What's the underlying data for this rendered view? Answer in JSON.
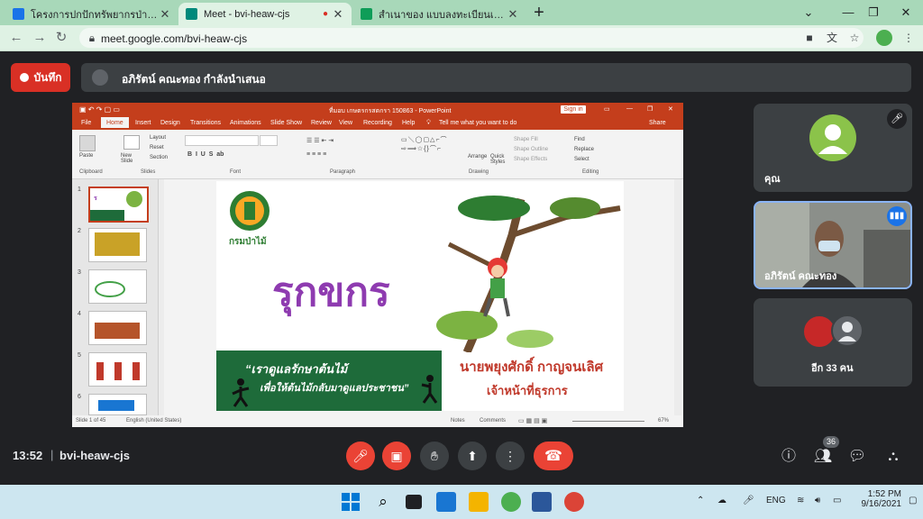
{
  "browser": {
    "tabs": [
      {
        "title": "โครงการปกปักทรัพยากรป่าตะเคียนทอง",
        "favicon_color": "#1a73e8"
      },
      {
        "title": "Meet - bvi-heaw-cjs",
        "favicon_color": "#00897b",
        "active": true
      },
      {
        "title": "สำเนาของ แบบลงทะเบียนเข้าร่วมกิจกร",
        "favicon_color": "#0f9d58"
      }
    ],
    "url": "meet.google.com/bvi-heaw-cjs"
  },
  "meet": {
    "record_label": "บันทึก",
    "presenter_text": "อภิรัตน์ คณะทอง กำลังนำเสนอ",
    "tiles": [
      {
        "name": "คุณ"
      },
      {
        "name": "อภิรัตน์ คณะทอง"
      },
      {
        "name": "อีก 33 คน"
      }
    ],
    "time": "13:52",
    "meeting_code": "bvi-heaw-cjs",
    "participant_count": "36"
  },
  "ppt": {
    "filename": "ที่มอบ เกษตรกรสตกรา 150863 - PowerPoint",
    "signin": "Sign in",
    "tabs": [
      "File",
      "Home",
      "Insert",
      "Design",
      "Transitions",
      "Animations",
      "Slide Show",
      "Review",
      "View",
      "Recording",
      "Help"
    ],
    "tell_me": "Tell me what you want to do",
    "share": "Share",
    "groups": [
      "Clipboard",
      "Slides",
      "Font",
      "Paragraph",
      "Drawing",
      "Editing"
    ],
    "ribbon_items": {
      "paste": "Paste",
      "new_slide": "New Slide",
      "layout": "Layout",
      "reset": "Reset",
      "section": "Section",
      "arrange": "Arrange",
      "quick_styles": "Quick Styles",
      "shape_fill": "Shape Fill",
      "shape_outline": "Shape Outline",
      "shape_effects": "Shape Effects",
      "find": "Find",
      "replace": "Replace",
      "select": "Select"
    },
    "thumb_numbers": [
      "1",
      "2",
      "3",
      "4",
      "5",
      "6"
    ],
    "status_slide": "Slide 1 of 45",
    "status_lang": "English (United States)",
    "status_notes": "Notes",
    "status_comments": "Comments",
    "zoom": "67%",
    "slide": {
      "logo_text": "กรมป่าไม้",
      "title": "รุกขกร",
      "banner_line1": "“เราดูแลรักษาต้นไม้",
      "banner_line2": "เพื่อให้ต้นไม้กลับมาดูแลประชาชน”",
      "person_name": "นายพยุงศักดิ์ กาญจนเลิศ",
      "person_title": "เจ้าหน้าที่ธุรการ"
    }
  },
  "taskbar": {
    "lang": "ENG",
    "clock_time": "1:52 PM",
    "clock_date": "9/16/2021"
  },
  "colors": {
    "record_red": "#d93025",
    "ppt_orange": "#c43e1c",
    "slide_purple": "#8e3bb0",
    "slide_green": "#1e6b3a",
    "slide_red": "#c0392b"
  }
}
